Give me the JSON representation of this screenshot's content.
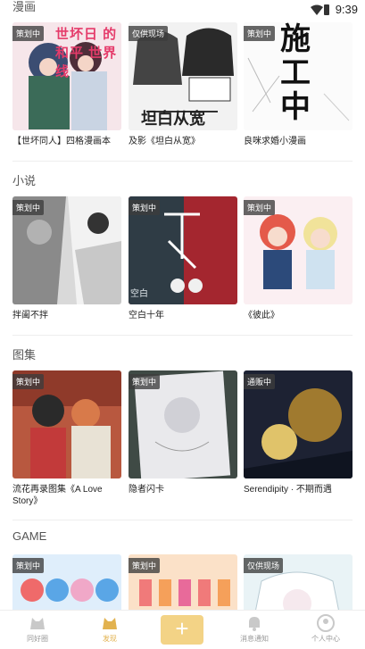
{
  "status": {
    "time": "9:39"
  },
  "sections": [
    {
      "title": "漫画",
      "cards": [
        {
          "badge": "策划中",
          "caption": "【世坏同人】四格漫画本"
        },
        {
          "badge": "仅供现场",
          "caption": "及影《坦白从宽》"
        },
        {
          "badge": "策划中",
          "caption": "良咪求婚小漫画"
        }
      ]
    },
    {
      "title": "小说",
      "cards": [
        {
          "badge": "策划中",
          "caption": "拌阖不拌"
        },
        {
          "badge": "策划中",
          "caption": "空白十年"
        },
        {
          "badge": "策划中",
          "caption": "《彼此》"
        }
      ]
    },
    {
      "title": "图集",
      "cards": [
        {
          "badge": "策划中",
          "caption": "流花再录图集《A Love Story》"
        },
        {
          "badge": "策划中",
          "caption": "隐者闪卡"
        },
        {
          "badge": "通贩中",
          "caption": "Serendipity · 不期而遇"
        }
      ]
    },
    {
      "title": "GAME",
      "cards": [
        {
          "badge": "策划中",
          "caption": ""
        },
        {
          "badge": "策划中",
          "caption": ""
        },
        {
          "badge": "仅供现场",
          "caption": ""
        }
      ]
    }
  ],
  "artwork_text": {
    "c1": "世坏日 的 和平 世界线",
    "c2": "坦白从宽",
    "c3": "施工中",
    "c5": "空白"
  },
  "nav": {
    "items": [
      "同好圈",
      "发现",
      "消息通知",
      "个人中心"
    ],
    "add": "+",
    "active_color": "#e2b24f"
  }
}
